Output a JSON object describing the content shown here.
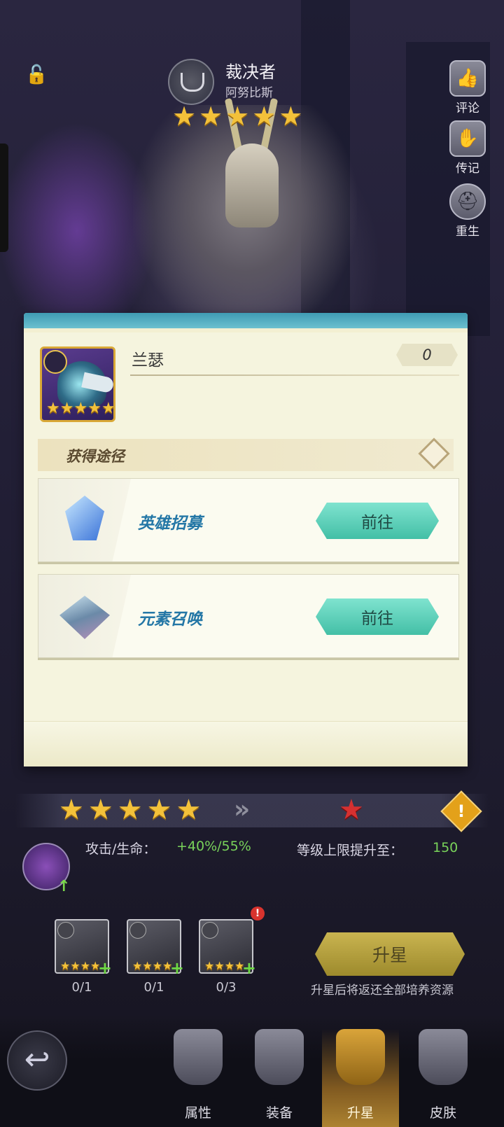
{
  "hero": {
    "class_title": "裁决者",
    "name": "阿努比斯",
    "stars": 5
  },
  "side_menu": {
    "items": [
      {
        "label": "评论",
        "icon": "thumbs-up-card-icon"
      },
      {
        "label": "传记",
        "icon": "biography-card-icon"
      },
      {
        "label": "重生",
        "icon": "rebirth-helmet-icon"
      }
    ]
  },
  "popup": {
    "item_name": "兰瑟",
    "item_stars": 5,
    "owned_count": "0",
    "section_title": "获得途径",
    "sources": [
      {
        "label": "英雄招募",
        "icon": "crystal-recruit-icon",
        "button": "前往"
      },
      {
        "label": "元素召唤",
        "icon": "elemental-book-icon",
        "button": "前往"
      }
    ]
  },
  "upgrade": {
    "current_stars": 5,
    "stat_label": "攻击/生命：",
    "stat_value": "+40%/55%",
    "level_label": "等级上限提升至：",
    "level_value": "150",
    "materials": [
      {
        "count": "0/1",
        "stars": 4
      },
      {
        "count": "0/1",
        "stars": 4
      },
      {
        "count": "0/3",
        "stars": 4
      }
    ],
    "alert_mark": "!",
    "button_label": "升星",
    "note": "升星后将返还全部培养资源"
  },
  "nav": {
    "items": [
      {
        "label": "属性"
      },
      {
        "label": "装备"
      },
      {
        "label": "升星"
      },
      {
        "label": "皮肤"
      }
    ],
    "active": "升星"
  },
  "colors": {
    "accent_green": "#79d35a",
    "go_button": "#43bfa6",
    "star_gold": "#f3c13a",
    "upgrade_gold": "#c9b450"
  }
}
